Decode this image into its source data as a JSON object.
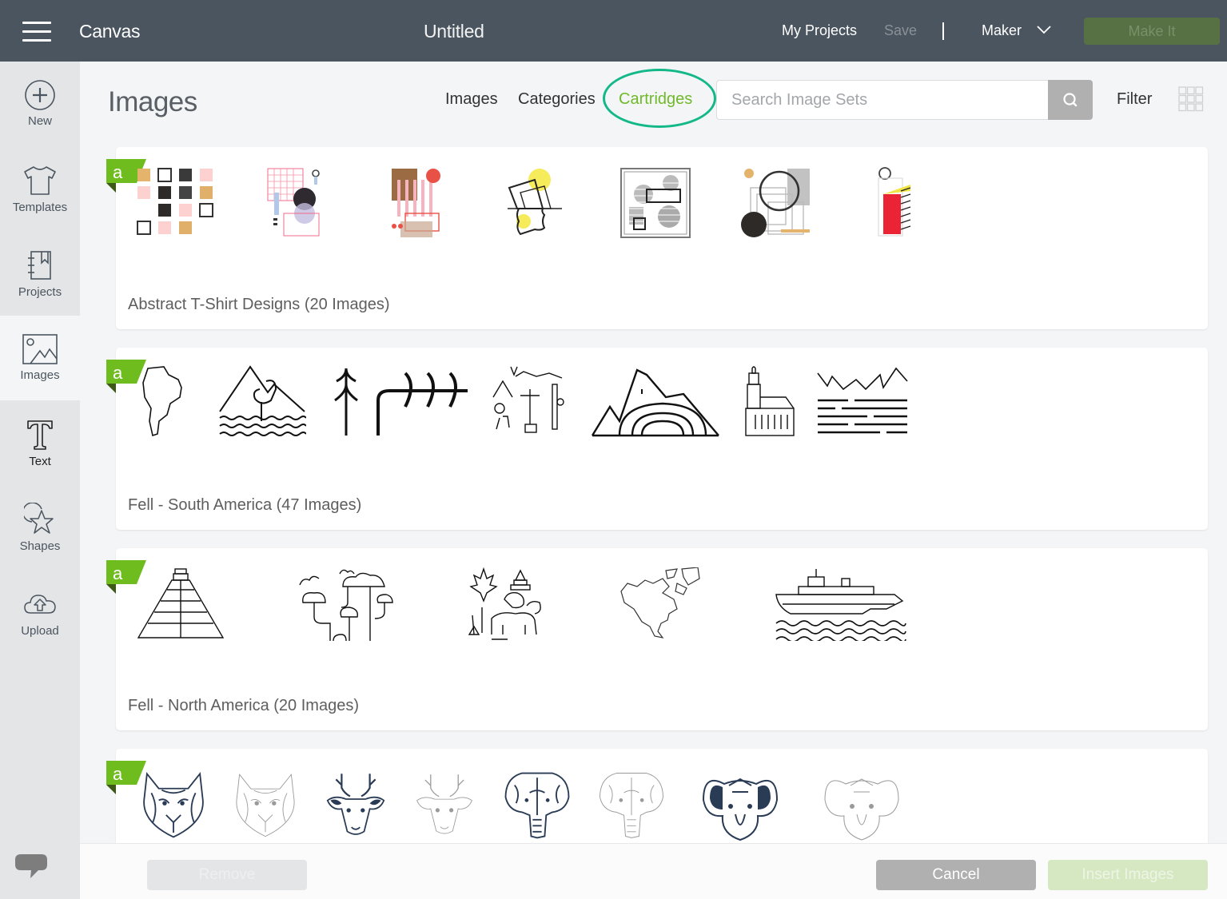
{
  "topbar": {
    "app_title": "Canvas",
    "document_title": "Untitled",
    "my_projects": "My Projects",
    "save": "Save",
    "machine": "Maker",
    "make_it": "Make It"
  },
  "sidebar": {
    "items": [
      {
        "label": "New",
        "icon": "plus-circle-icon"
      },
      {
        "label": "Templates",
        "icon": "tshirt-icon"
      },
      {
        "label": "Projects",
        "icon": "notebook-icon"
      },
      {
        "label": "Images",
        "icon": "image-icon",
        "active": true
      },
      {
        "label": "Text",
        "icon": "text-T-icon"
      },
      {
        "label": "Shapes",
        "icon": "shapes-icon"
      },
      {
        "label": "Upload",
        "icon": "cloud-upload-icon"
      }
    ],
    "chat_icon": "chat-bubble-icon"
  },
  "header": {
    "title": "Images",
    "tabs": [
      {
        "label": "Images",
        "active": false
      },
      {
        "label": "Categories",
        "active": false
      },
      {
        "label": "Cartridges",
        "active": true
      }
    ],
    "search_placeholder": "Search Image Sets",
    "search_value": "",
    "filter": "Filter"
  },
  "accent_color": "#70b92a",
  "highlight_ring_color": "#13b888",
  "cartridges": [
    {
      "label": "Abstract T-Shirt Designs (20 Images)",
      "access_badge": "a",
      "thumbnails": [
        "abstract-squares-grid",
        "pink-grid-circle",
        "stripes-red-circle",
        "yellow-tilted-frames",
        "gray-striped-frame",
        "circles-frames",
        "red-block-tag"
      ]
    },
    {
      "label": "Fell - South America (47 Images)",
      "access_badge": "a",
      "thumbnails": [
        "south-america-map",
        "heron-mountain-waves",
        "tree-arrows",
        "rio-landmarks",
        "mountain-arches",
        "church-tower",
        "mountains-lake"
      ]
    },
    {
      "label": "Fell - North America (20 Images)",
      "access_badge": "a",
      "thumbnails": [
        "step-pyramid",
        "forest-trees",
        "canada-wildlife",
        "north-america-map",
        "ship-on-waves"
      ]
    },
    {
      "label": "",
      "access_badge": "a",
      "thumbnails": [
        "wolf-head-dark",
        "wolf-head-light",
        "deer-head-dark",
        "deer-head-light",
        "elephant-head-dark",
        "elephant-head-light",
        "koala-head-dark",
        "koala-head-light"
      ]
    }
  ],
  "footer": {
    "remove": "Remove",
    "cancel": "Cancel",
    "insert": "Insert Images"
  }
}
